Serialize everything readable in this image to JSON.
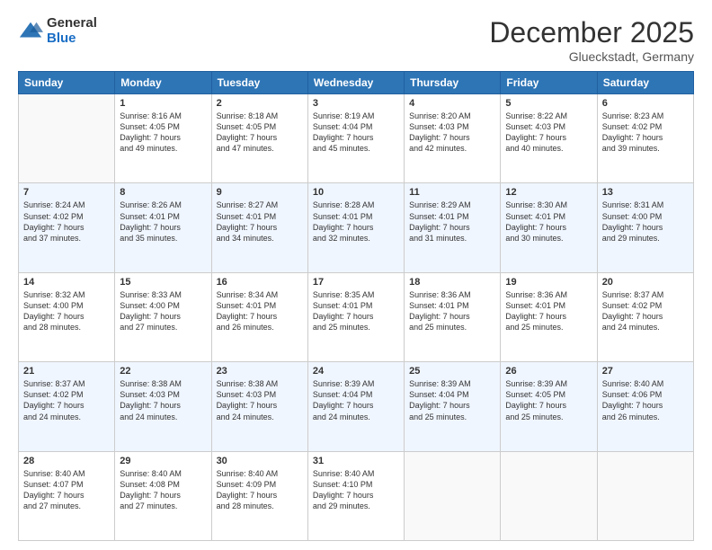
{
  "logo": {
    "general": "General",
    "blue": "Blue"
  },
  "title": {
    "month_year": "December 2025",
    "location": "Glueckstadt, Germany"
  },
  "days_of_week": [
    "Sunday",
    "Monday",
    "Tuesday",
    "Wednesday",
    "Thursday",
    "Friday",
    "Saturday"
  ],
  "weeks": [
    [
      {
        "day": "",
        "info": ""
      },
      {
        "day": "1",
        "info": "Sunrise: 8:16 AM\nSunset: 4:05 PM\nDaylight: 7 hours\nand 49 minutes."
      },
      {
        "day": "2",
        "info": "Sunrise: 8:18 AM\nSunset: 4:05 PM\nDaylight: 7 hours\nand 47 minutes."
      },
      {
        "day": "3",
        "info": "Sunrise: 8:19 AM\nSunset: 4:04 PM\nDaylight: 7 hours\nand 45 minutes."
      },
      {
        "day": "4",
        "info": "Sunrise: 8:20 AM\nSunset: 4:03 PM\nDaylight: 7 hours\nand 42 minutes."
      },
      {
        "day": "5",
        "info": "Sunrise: 8:22 AM\nSunset: 4:03 PM\nDaylight: 7 hours\nand 40 minutes."
      },
      {
        "day": "6",
        "info": "Sunrise: 8:23 AM\nSunset: 4:02 PM\nDaylight: 7 hours\nand 39 minutes."
      }
    ],
    [
      {
        "day": "7",
        "info": "Sunrise: 8:24 AM\nSunset: 4:02 PM\nDaylight: 7 hours\nand 37 minutes."
      },
      {
        "day": "8",
        "info": "Sunrise: 8:26 AM\nSunset: 4:01 PM\nDaylight: 7 hours\nand 35 minutes."
      },
      {
        "day": "9",
        "info": "Sunrise: 8:27 AM\nSunset: 4:01 PM\nDaylight: 7 hours\nand 34 minutes."
      },
      {
        "day": "10",
        "info": "Sunrise: 8:28 AM\nSunset: 4:01 PM\nDaylight: 7 hours\nand 32 minutes."
      },
      {
        "day": "11",
        "info": "Sunrise: 8:29 AM\nSunset: 4:01 PM\nDaylight: 7 hours\nand 31 minutes."
      },
      {
        "day": "12",
        "info": "Sunrise: 8:30 AM\nSunset: 4:01 PM\nDaylight: 7 hours\nand 30 minutes."
      },
      {
        "day": "13",
        "info": "Sunrise: 8:31 AM\nSunset: 4:00 PM\nDaylight: 7 hours\nand 29 minutes."
      }
    ],
    [
      {
        "day": "14",
        "info": "Sunrise: 8:32 AM\nSunset: 4:00 PM\nDaylight: 7 hours\nand 28 minutes."
      },
      {
        "day": "15",
        "info": "Sunrise: 8:33 AM\nSunset: 4:00 PM\nDaylight: 7 hours\nand 27 minutes."
      },
      {
        "day": "16",
        "info": "Sunrise: 8:34 AM\nSunset: 4:01 PM\nDaylight: 7 hours\nand 26 minutes."
      },
      {
        "day": "17",
        "info": "Sunrise: 8:35 AM\nSunset: 4:01 PM\nDaylight: 7 hours\nand 25 minutes."
      },
      {
        "day": "18",
        "info": "Sunrise: 8:36 AM\nSunset: 4:01 PM\nDaylight: 7 hours\nand 25 minutes."
      },
      {
        "day": "19",
        "info": "Sunrise: 8:36 AM\nSunset: 4:01 PM\nDaylight: 7 hours\nand 25 minutes."
      },
      {
        "day": "20",
        "info": "Sunrise: 8:37 AM\nSunset: 4:02 PM\nDaylight: 7 hours\nand 24 minutes."
      }
    ],
    [
      {
        "day": "21",
        "info": "Sunrise: 8:37 AM\nSunset: 4:02 PM\nDaylight: 7 hours\nand 24 minutes."
      },
      {
        "day": "22",
        "info": "Sunrise: 8:38 AM\nSunset: 4:03 PM\nDaylight: 7 hours\nand 24 minutes."
      },
      {
        "day": "23",
        "info": "Sunrise: 8:38 AM\nSunset: 4:03 PM\nDaylight: 7 hours\nand 24 minutes."
      },
      {
        "day": "24",
        "info": "Sunrise: 8:39 AM\nSunset: 4:04 PM\nDaylight: 7 hours\nand 24 minutes."
      },
      {
        "day": "25",
        "info": "Sunrise: 8:39 AM\nSunset: 4:04 PM\nDaylight: 7 hours\nand 25 minutes."
      },
      {
        "day": "26",
        "info": "Sunrise: 8:39 AM\nSunset: 4:05 PM\nDaylight: 7 hours\nand 25 minutes."
      },
      {
        "day": "27",
        "info": "Sunrise: 8:40 AM\nSunset: 4:06 PM\nDaylight: 7 hours\nand 26 minutes."
      }
    ],
    [
      {
        "day": "28",
        "info": "Sunrise: 8:40 AM\nSunset: 4:07 PM\nDaylight: 7 hours\nand 27 minutes."
      },
      {
        "day": "29",
        "info": "Sunrise: 8:40 AM\nSunset: 4:08 PM\nDaylight: 7 hours\nand 27 minutes."
      },
      {
        "day": "30",
        "info": "Sunrise: 8:40 AM\nSunset: 4:09 PM\nDaylight: 7 hours\nand 28 minutes."
      },
      {
        "day": "31",
        "info": "Sunrise: 8:40 AM\nSunset: 4:10 PM\nDaylight: 7 hours\nand 29 minutes."
      },
      {
        "day": "",
        "info": ""
      },
      {
        "day": "",
        "info": ""
      },
      {
        "day": "",
        "info": ""
      }
    ]
  ]
}
